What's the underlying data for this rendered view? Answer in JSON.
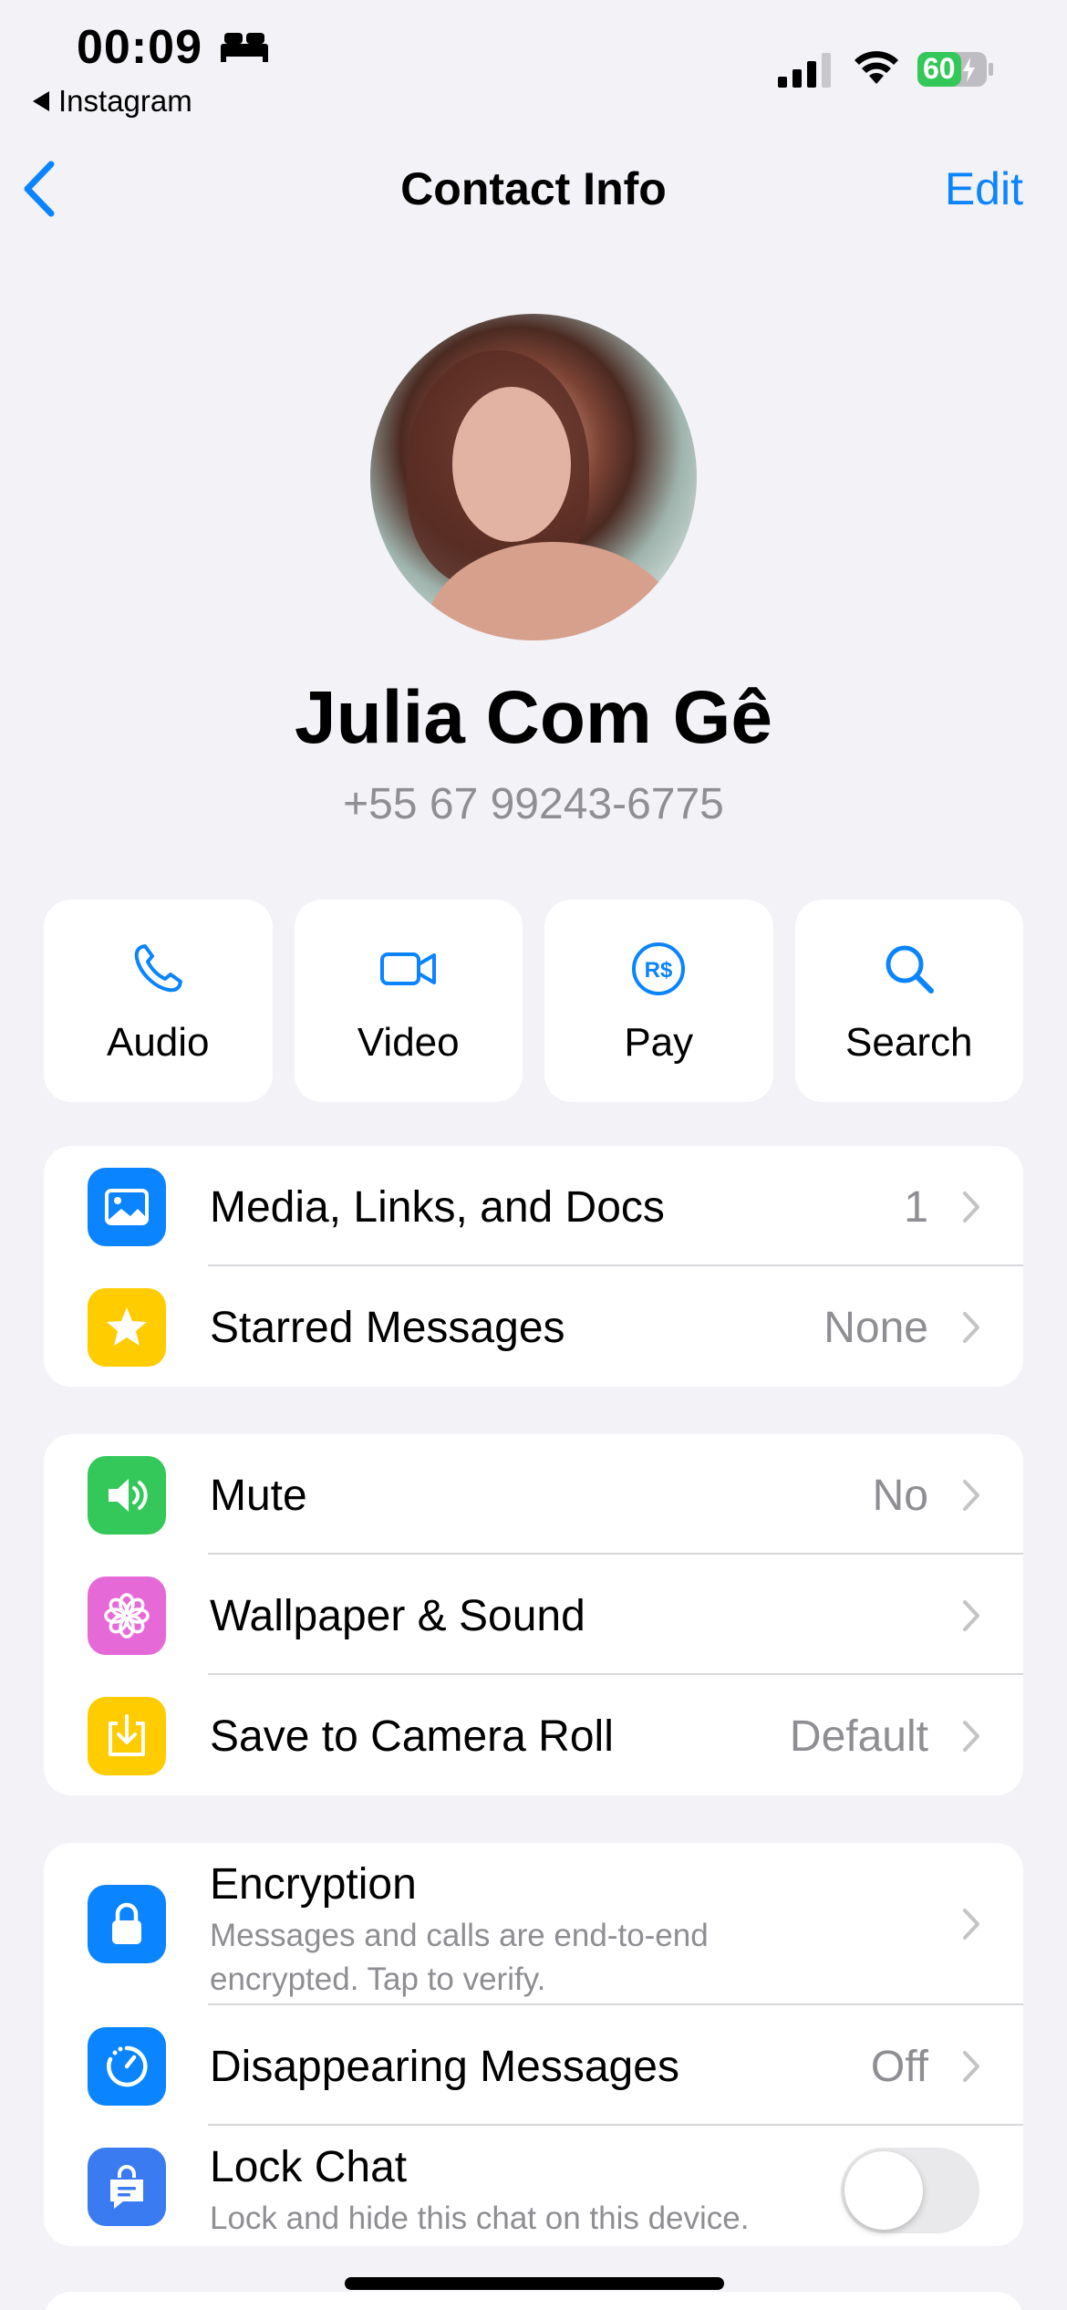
{
  "status": {
    "time": "00:09",
    "back_app": "Instagram",
    "battery": "60"
  },
  "nav": {
    "title": "Contact Info",
    "edit": "Edit"
  },
  "profile": {
    "name": "Julia Com Gê",
    "phone": "+55 67 99243-6775"
  },
  "actions": [
    {
      "label": "Audio",
      "icon": "phone-icon"
    },
    {
      "label": "Video",
      "icon": "video-icon"
    },
    {
      "label": "Pay",
      "icon": "pay-icon"
    },
    {
      "label": "Search",
      "icon": "search-icon"
    }
  ],
  "group1": [
    {
      "label": "Media, Links, and Docs",
      "value": "1",
      "icon": "photo-icon",
      "color": "#0a84ff"
    },
    {
      "label": "Starred Messages",
      "value": "None",
      "icon": "star-icon",
      "color": "#ffcc00"
    }
  ],
  "group2": [
    {
      "label": "Mute",
      "value": "No",
      "icon": "speaker-icon",
      "color": "#34c759"
    },
    {
      "label": "Wallpaper & Sound",
      "value": "",
      "icon": "flower-icon",
      "color": "#e56ad8"
    },
    {
      "label": "Save to Camera Roll",
      "value": "Default",
      "icon": "download-icon",
      "color": "#ffcc00"
    }
  ],
  "group3": {
    "encryption": {
      "label": "Encryption",
      "sub": "Messages and calls are end-to-end encrypted. Tap to verify.",
      "icon": "lock-icon",
      "color": "#0a84ff"
    },
    "disappearing": {
      "label": "Disappearing Messages",
      "value": "Off",
      "icon": "timer-icon",
      "color": "#0a84ff"
    },
    "lock_chat": {
      "label": "Lock Chat",
      "sub": "Lock and hide this chat on this device.",
      "icon": "lock-chat-icon",
      "color": "#3a7bf2",
      "enabled": false
    }
  },
  "colors": {
    "accent": "#0a84ff",
    "background": "#f2f2f7",
    "secondary_text": "#8e8e93"
  }
}
